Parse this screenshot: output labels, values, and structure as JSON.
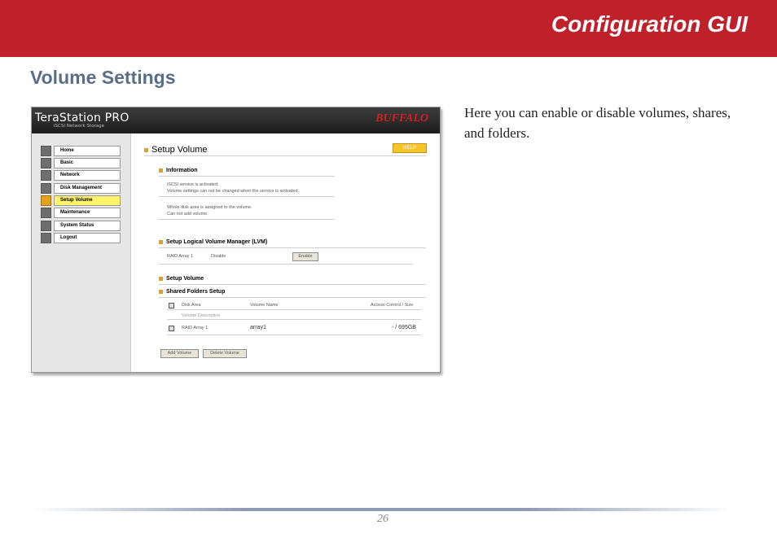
{
  "banner": {
    "title": "Configuration GUI"
  },
  "section_title": "Volume Settings",
  "description": "Here you can enable or disable volumes, shares, and folders.",
  "screenshot": {
    "brand": "TeraStation PRO",
    "brand_sub": "iSCSI Network Storage",
    "logo": "BUFFALO",
    "nav": [
      {
        "label": "Home",
        "icon": "home-icon"
      },
      {
        "label": "Basic",
        "icon": "basic-icon"
      },
      {
        "label": "Network",
        "icon": "network-icon"
      },
      {
        "label": "Disk Management",
        "icon": "disk-icon"
      },
      {
        "label": "Setup Volume",
        "icon": "volume-icon",
        "selected": true
      },
      {
        "label": "Maintenance",
        "icon": "maintenance-icon"
      },
      {
        "label": "System Status",
        "icon": "status-icon"
      },
      {
        "label": "Logout",
        "icon": "logout-icon"
      }
    ],
    "main_title": "Setup Volume",
    "help_label": "HELP",
    "information": {
      "title": "Information",
      "line1": "iSCSI service is activated.",
      "line2": "Volume settings can not be changed when the service is activated.",
      "line3": "Whole disk area is assigned to the volume.",
      "line4": "Can not add volume."
    },
    "lvm": {
      "title": "Setup Logical Volume Manager (LVM)",
      "array": "RAID Array 1",
      "status": "Disable",
      "button": "Enable"
    },
    "setup_volume_title": "Setup Volume",
    "shared": {
      "title": "Shared Folders Setup",
      "col_disk": "Disk Area",
      "col_name": "Volume Name",
      "col_access": "Access Control / Size",
      "col_desc": "Volume Description",
      "row_disk": "RAID Array 1",
      "row_name": "array1",
      "row_size": "- / 695GB"
    },
    "add_button": "Add Volume",
    "delete_button": "Delete Volume"
  },
  "page_number": "26",
  "colors": {
    "banner": "#c0202a",
    "heading": "#5a6e86"
  }
}
